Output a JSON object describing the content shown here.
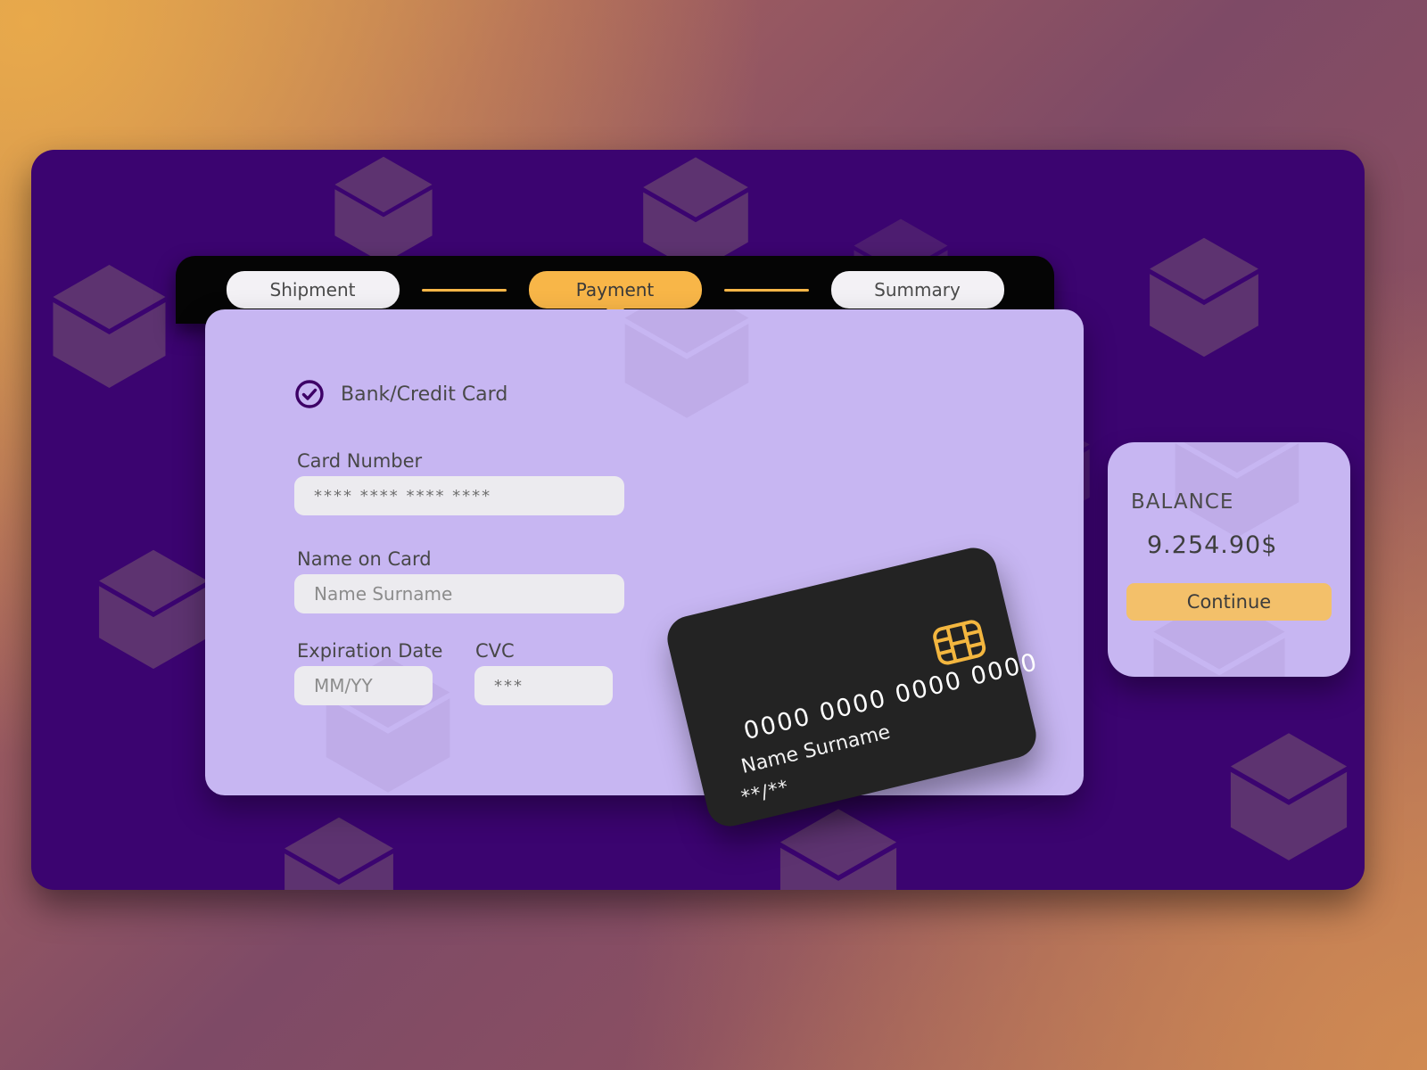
{
  "theme": {
    "page_gradient_start": "#e8a94b",
    "page_gradient_mid": "#7e4a66",
    "page_gradient_end": "#d08a52",
    "container_bg": "#3b0470",
    "cube_color": "#5d3370",
    "panel_bg": "#c7b6f2",
    "topbar_bg": "#050505",
    "accent": "#f8b648",
    "button_bg": "#f3c06a",
    "input_bg": "#ecebef",
    "card_bg": "#232323",
    "check_color": "#3d0066"
  },
  "stepper": {
    "steps": [
      {
        "label": "Shipment",
        "active": false
      },
      {
        "label": "Payment",
        "active": true
      },
      {
        "label": "Summary",
        "active": false
      }
    ]
  },
  "payment_method": {
    "label": "Bank/Credit Card",
    "icon": "check-circle-icon",
    "selected": true
  },
  "form": {
    "card_number": {
      "label": "Card Number",
      "value": "",
      "placeholder": "**** **** **** ****"
    },
    "name_on_card": {
      "label": "Name on Card",
      "value": "",
      "placeholder": "Name Surname"
    },
    "expiration": {
      "label": "Expiration Date",
      "value": "",
      "placeholder": "MM/YY"
    },
    "cvc": {
      "label": "CVC",
      "value": "",
      "placeholder": "***"
    }
  },
  "credit_card_preview": {
    "number": "0000 0000 0000 0000",
    "name": "Name Surname",
    "expiry": "**/**",
    "chip_icon": "chip-icon"
  },
  "balance_panel": {
    "title": "BALANCE",
    "amount": "9.254.90$",
    "continue_label": "Continue"
  }
}
